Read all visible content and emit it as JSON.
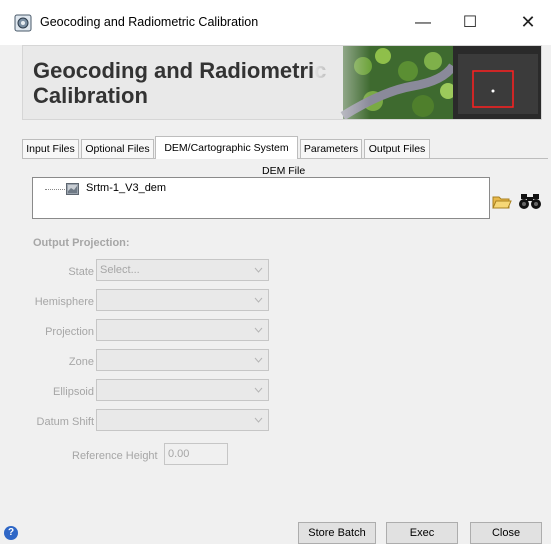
{
  "window": {
    "title": "Geocoding and Radiometric Calibration",
    "controls": {
      "minimize": "—",
      "maximize": "☐",
      "close": "✕"
    }
  },
  "banner": {
    "title": "Geocoding and Radiometric Calibration"
  },
  "tabs": [
    {
      "label": "Input Files",
      "active": false
    },
    {
      "label": "Optional Files",
      "active": false
    },
    {
      "label": "DEM/Cartographic System",
      "active": true
    },
    {
      "label": "Parameters",
      "active": false
    },
    {
      "label": "Output Files",
      "active": false
    }
  ],
  "dem": {
    "legend": "DEM File",
    "file_label": "Srtm-1_V3_dem",
    "icons": [
      "folder-open-icon",
      "binoculars-icon"
    ]
  },
  "output_projection": {
    "heading": "Output Projection:",
    "fields": [
      {
        "label": "State",
        "value": "Select..."
      },
      {
        "label": "Hemisphere",
        "value": ""
      },
      {
        "label": "Projection",
        "value": ""
      },
      {
        "label": "Zone",
        "value": ""
      },
      {
        "label": "Ellipsoid",
        "value": ""
      },
      {
        "label": "Datum Shift",
        "value": ""
      }
    ],
    "reference_height": {
      "label": "Reference Height",
      "value": "0.00"
    }
  },
  "buttons": {
    "help": "?",
    "store_batch": "Store Batch",
    "exec": "Exec",
    "close": "Close"
  },
  "colors": {
    "disabled_text": "#a6a6a6",
    "help_blue": "#2f67c6",
    "highlight_red": "#ff2020"
  }
}
